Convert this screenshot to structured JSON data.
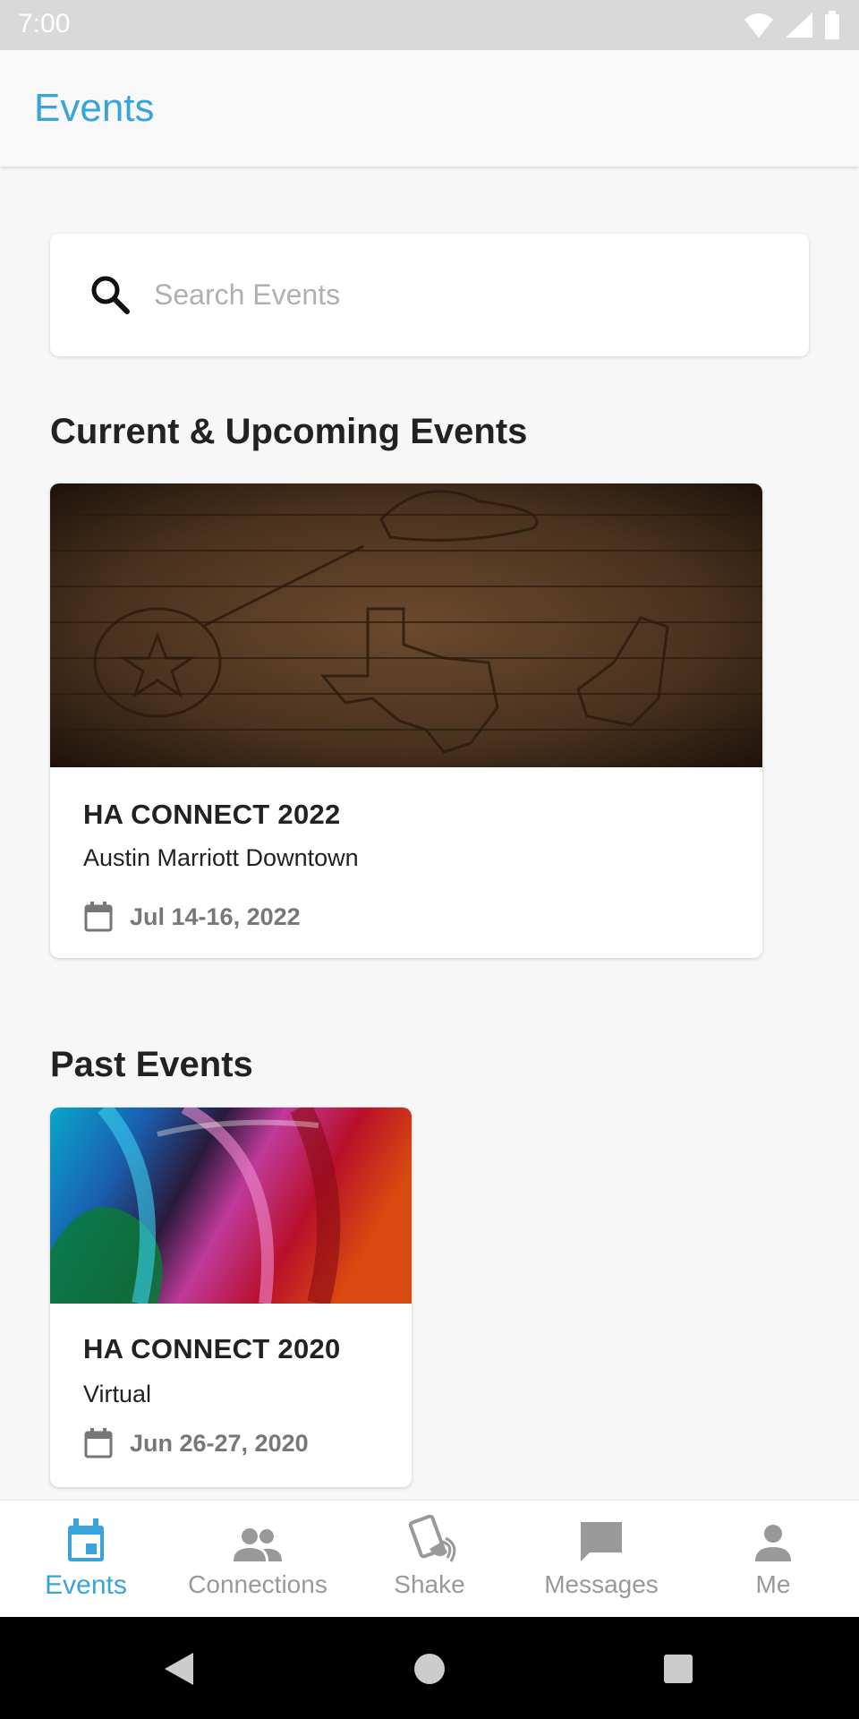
{
  "status_bar": {
    "time": "7:00"
  },
  "app_bar": {
    "title": "Events"
  },
  "search": {
    "placeholder": "Search Events",
    "value": ""
  },
  "sections": {
    "current_title": "Current & Upcoming Events",
    "past_title": "Past Events"
  },
  "current_events": [
    {
      "title": "HA CONNECT 2022",
      "venue": "Austin Marriott Downtown",
      "date": "Jul 14-16, 2022",
      "image": "wood-texas-banner"
    }
  ],
  "past_events": [
    {
      "title": "HA CONNECT 2020",
      "venue": "Virtual",
      "date": "Jun 26-27, 2020",
      "image": "colorful-swirl-banner"
    }
  ],
  "bottom_nav": {
    "items": [
      {
        "label": "Events",
        "icon": "calendar-icon",
        "active": true
      },
      {
        "label": "Connections",
        "icon": "people-icon",
        "active": false
      },
      {
        "label": "Shake",
        "icon": "shake-phone-icon",
        "active": false
      },
      {
        "label": "Messages",
        "icon": "message-icon",
        "active": false
      },
      {
        "label": "Me",
        "icon": "person-icon",
        "active": false
      }
    ]
  },
  "colors": {
    "accent": "#3aa3da",
    "inactive": "#999999",
    "background": "#f7f7f7"
  }
}
